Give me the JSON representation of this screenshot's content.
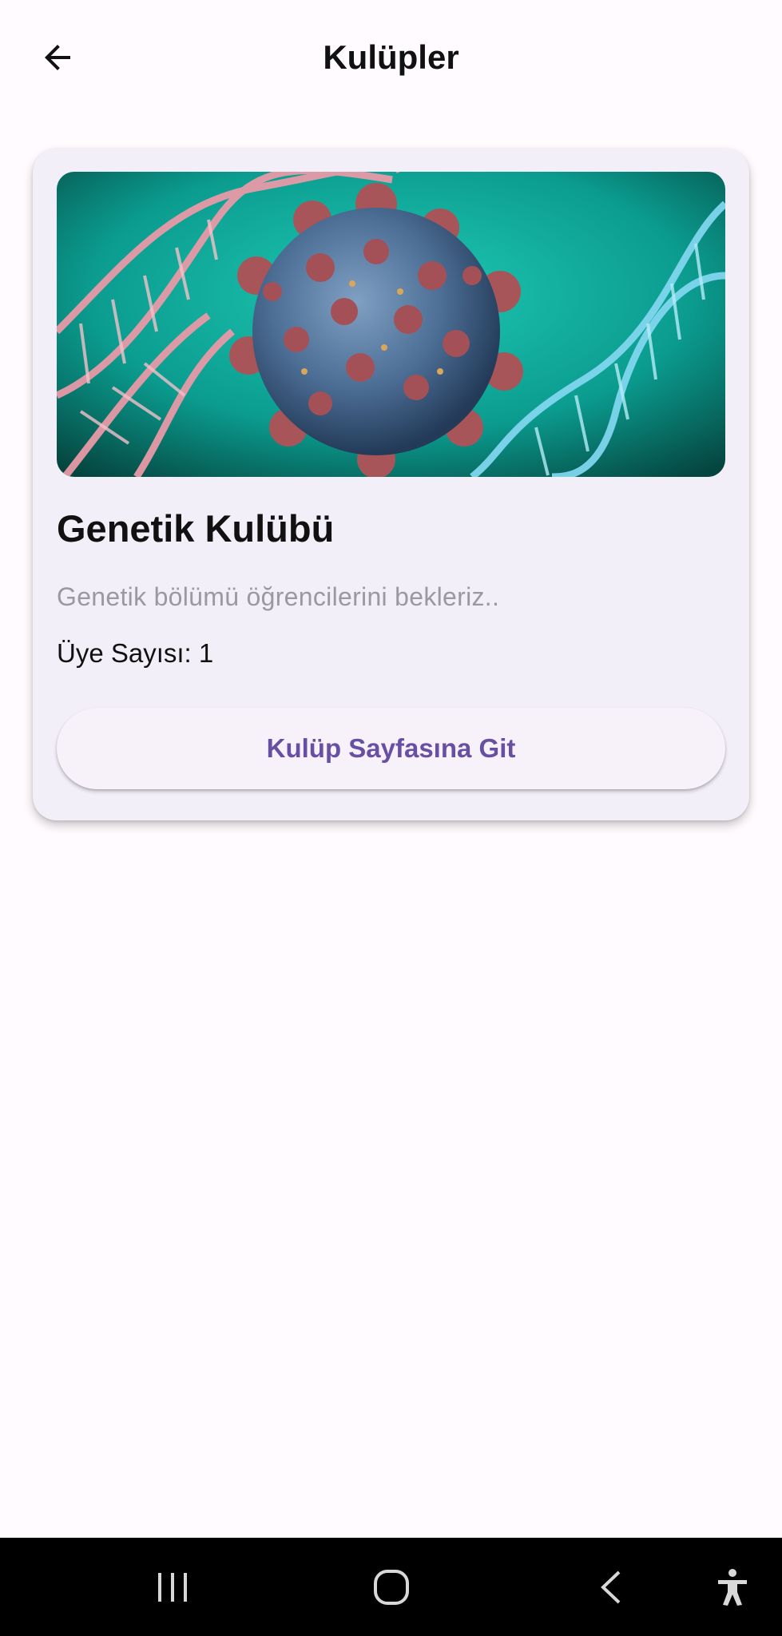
{
  "appbar": {
    "title": "Kulüpler",
    "back_icon": "arrow-left-icon"
  },
  "club": {
    "name": "Genetik Kulübü",
    "description": "Genetik bölümü öğrencilerini bekleriz..",
    "member_count_text": "Üye Sayısı: 1",
    "button_label": "Kulüp Sayfasına Git",
    "image_subject": "virus-dna-illustration"
  },
  "navbar": {
    "recents_icon": "recent-apps-icon",
    "home_icon": "home-icon",
    "back_icon": "back-icon",
    "accessibility_icon": "accessibility-icon"
  },
  "colors": {
    "background": "#fffbfe",
    "card": "#f3eff8",
    "button_text": "#6750a4",
    "description_text": "#9b98a0",
    "navbar": "#000000"
  }
}
